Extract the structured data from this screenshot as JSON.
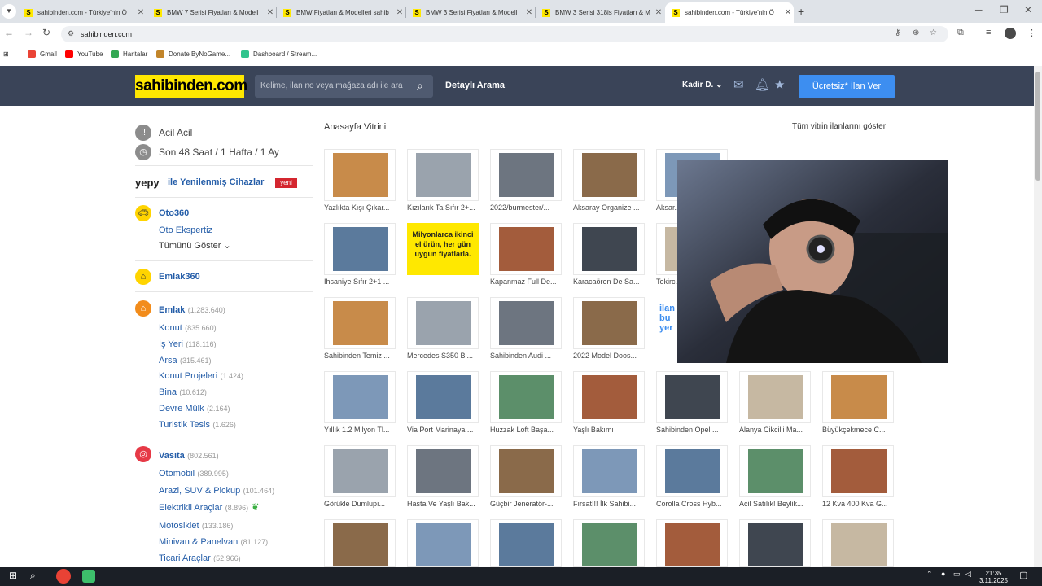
{
  "browser": {
    "tabs": [
      {
        "title": "sahibinden.com - Türkiye'nin Ö",
        "active": false
      },
      {
        "title": "BMW 7 Serisi Fiyatları & Modell",
        "active": false
      },
      {
        "title": "BMW Fiyatları & Modelleri sahib",
        "active": false
      },
      {
        "title": "BMW 3 Serisi Fiyatları & Modell",
        "active": false
      },
      {
        "title": "BMW 3 Serisi 318is Fiyatları & M",
        "active": false
      },
      {
        "title": "sahibinden.com - Türkiye'nin Ö",
        "active": true
      }
    ],
    "url": "sahibinden.com",
    "bookmarks": [
      "Gmail",
      "YouTube",
      "Haritalar",
      "Donate ByNoGame...",
      "Dashboard / Stream..."
    ]
  },
  "header": {
    "logo": "sahibinden.com",
    "search_placeholder": "Kelime, ilan no veya mağaza adı ile ara",
    "advanced_search": "Detaylı Arama",
    "user_name": "Kadir D.",
    "cta": "Ücretsiz* İlan Ver"
  },
  "sidebar": {
    "acil": "Acil Acil",
    "son48": "Son 48 Saat / 1 Hafta / 1 Ay",
    "yepy_brand": "yepy",
    "yepy_text": "ile Yenilenmiş Cihazlar",
    "yeni_badge": "yeni",
    "oto360": "Oto360",
    "oto_ekspertiz": "Oto Ekspertiz",
    "tumunu_goster": "Tümünü Göster",
    "emlak360": "Emlak360",
    "emlak": {
      "label": "Emlak",
      "count": "(1.283.640)"
    },
    "emlak_items": [
      {
        "label": "Konut",
        "count": "(835.660)"
      },
      {
        "label": "İş Yeri",
        "count": "(118.116)"
      },
      {
        "label": "Arsa",
        "count": "(315.461)"
      },
      {
        "label": "Konut Projeleri",
        "count": "(1.424)"
      },
      {
        "label": "Bina",
        "count": "(10.612)"
      },
      {
        "label": "Devre Mülk",
        "count": "(2.164)"
      },
      {
        "label": "Turistik Tesis",
        "count": "(1.626)"
      }
    ],
    "vasita": {
      "label": "Vasıta",
      "count": "(802.561)"
    },
    "vasita_items": [
      {
        "label": "Otomobil",
        "count": "(389.995)"
      },
      {
        "label": "Arazi, SUV & Pickup",
        "count": "(101.464)"
      },
      {
        "label": "Elektrikli Araçlar",
        "count": "(8.896)"
      },
      {
        "label": "Motosiklet",
        "count": "(133.186)"
      },
      {
        "label": "Minivan & Panelvan",
        "count": "(81.127)"
      },
      {
        "label": "Ticari Araçlar",
        "count": "(52.966)"
      }
    ]
  },
  "vitrin": {
    "title": "Anasayfa Vitrini",
    "show_all": "Tüm vitrin ilanlarını göster",
    "rows": [
      [
        "Yazlıkta Kışı Çıkar...",
        "Kızılarık Ta Sıfır 2+...",
        "2022/burmester/...",
        "Aksaray Organize ...",
        "Aksar..."
      ],
      [
        "İhsaniye Sıfır 2+1 ...",
        "",
        "Kapanmaz Full De...",
        "Karacaören De Sa...",
        "Tekirc..."
      ],
      [
        "Sahibinden Temiz ...",
        "Mercedes S350 Bl...",
        "Sahibinden Audi ...",
        "2022 Model Doos..."
      ],
      [
        "Yıllık 1.2 Milyon Tl...",
        "Via Port Marinaya ...",
        "Huzzak Loft Başa...",
        "Yaşlı Bakımı",
        "Sahibinden Opel ...",
        "Alanya Cikcilli Ma...",
        "Büyükçekmece C..."
      ],
      [
        "Görükle Dumlupı...",
        "Hasta Ve Yaşlı Bak...",
        "Güçbir Jeneratör-...",
        "Fırsat!!! İlk Sahibi...",
        "Corolla Cross Hyb...",
        "Acil Satılık! Beylik...",
        "12 Kva 400 Kva G..."
      ]
    ],
    "ad_text": "Milyonlarca ikinci el ürün, her gün uygun fiyatlarla.",
    "ad_partial": "ilan bu yer"
  },
  "taskbar": {
    "time": "21:35",
    "date": "3.11.2025"
  }
}
